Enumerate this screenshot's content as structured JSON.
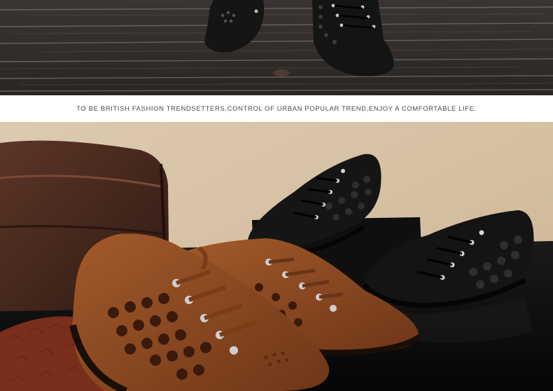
{
  "top_photo": {
    "description_icon": "shoes-on-wood-floor-photo",
    "colors": {
      "wood_dark": "#2b2725",
      "wood_light": "#6e6863",
      "shoe_black": "#141414"
    }
  },
  "caption": {
    "text": "TO BE BRITISH FASHION TRENDSETTERS,CONTROL OF URBAN POPULAR TREND,ENJOY A COMFORTABLE LIFE."
  },
  "bottom_photo": {
    "description_icon": "shoes-with-suitcase-photo",
    "colors": {
      "wall": "#d9c6a6",
      "suitcase": "#4a2a1e",
      "brown_shoe": "#8a4a22",
      "black_shoe": "#151515",
      "floor": "#0b0b0b"
    }
  }
}
